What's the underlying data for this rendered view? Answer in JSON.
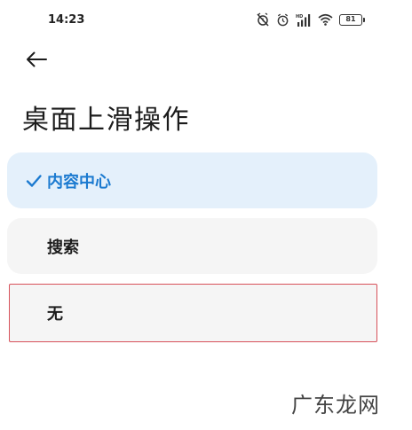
{
  "status_bar": {
    "time": "14:23",
    "battery": "81",
    "icons": [
      "alarm-off-icon",
      "alarm-clock-icon",
      "signal-hd-icon",
      "wifi-icon",
      "battery-icon"
    ]
  },
  "header": {
    "back_icon": "arrow-left-icon",
    "title": "桌面上滑操作"
  },
  "options": [
    {
      "label": "内容中心",
      "selected": true
    },
    {
      "label": "搜索",
      "selected": false
    },
    {
      "label": "无",
      "selected": false
    }
  ],
  "watermark": "广东龙网",
  "colors": {
    "accent": "#1b7ad0",
    "selected_bg": "#e4f0fb",
    "option_bg": "#f5f5f5",
    "highlight_border": "#d7515a"
  }
}
